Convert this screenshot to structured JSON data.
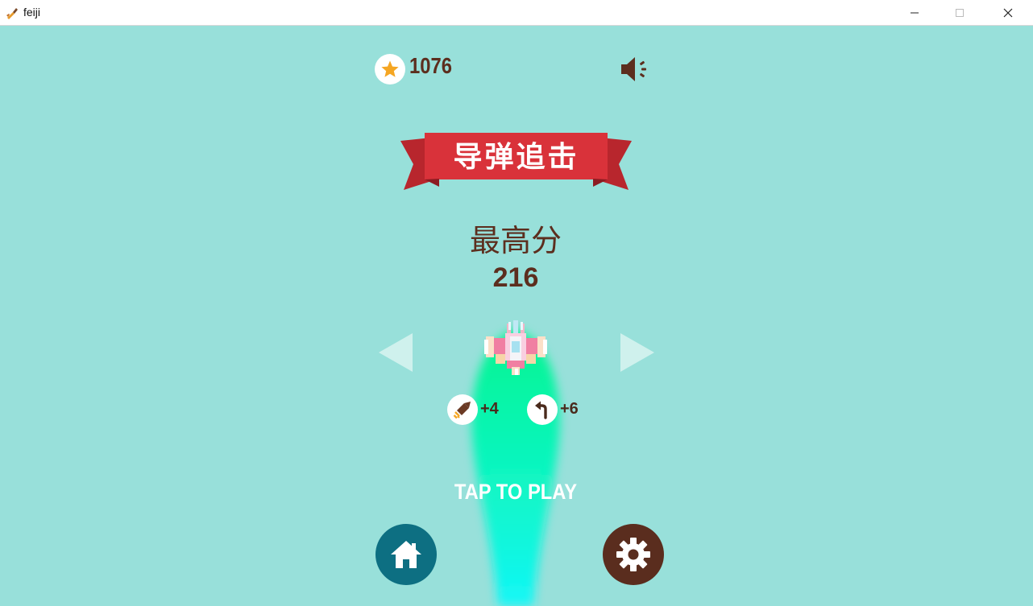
{
  "window": {
    "title": "feiji"
  },
  "hud": {
    "coins": "1076",
    "sound_icon": "speaker-on-icon"
  },
  "banner": {
    "title": "导弹追击",
    "color": "#d9323a"
  },
  "best": {
    "label": "最高分",
    "score": "216"
  },
  "perks": [
    {
      "icon": "missile-icon",
      "value": "+4"
    },
    {
      "icon": "turn-arrow-icon",
      "value": "+6"
    }
  ],
  "tap": {
    "label": "TAP TO PLAY"
  },
  "buttons": {
    "home_icon": "home-icon",
    "settings_icon": "gear-icon"
  },
  "colors": {
    "background": "#98e0da",
    "text_brown": "#5c2e1e",
    "home_teal": "#0d6f82",
    "settings_brown": "#5a2d1e",
    "glow_green": "#00f58c",
    "coin_star": "#f5a623"
  }
}
